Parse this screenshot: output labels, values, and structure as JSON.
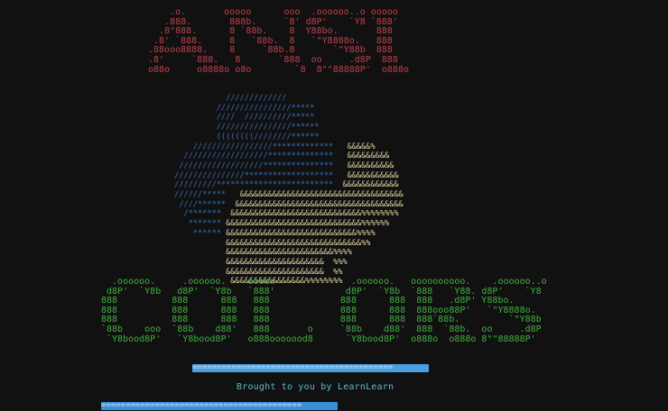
{
  "window": {
    "background": "#111111"
  },
  "ansi_art": {
    "color": "#c0404a",
    "lines": [
      "    .o.       ooooo      ooo  .oooooo..o ooooo",
      "   .888.       888b.     `8' d8P'    `Y8 `888'",
      "  .8\"888.      8 `88b.    8  Y88bo.       888",
      " .8' `888.     8   `88b.  8   `\"Y8888o.   888",
      ".88ooo8888.    8     `88b.8       `\"Y88b  888",
      ".8'     `888.   8       `888  oo     .d8P  888",
      "o88o     o8888o o8o        `8  8\"\"88888P'  o888o"
    ]
  },
  "python_logo": {
    "blue_color": "#3a6fb8",
    "yellow_color": "#e6d6a4",
    "lines": [
      {
        "blue": "            /////////////",
        "yellow": ""
      },
      {
        "blue": "          ////////////////*****",
        "yellow": ""
      },
      {
        "blue": "          ////  //////////*****",
        "yellow": ""
      },
      {
        "blue": "          ////////////////******",
        "yellow": ""
      },
      {
        "blue": "          ((((((((////////******",
        "yellow": ""
      },
      {
        "blue": "     /////////////////*************",
        "yellow": "   &&&&&%"
      },
      {
        "blue": "   //////////////////**************",
        "yellow": "   &&&&&&&&&"
      },
      {
        "blue": "  //////////////////***************",
        "yellow": "   &&&&&&&&&&"
      },
      {
        "blue": " ///////////////*******************",
        "yellow": "   &&&&&&&&&&&"
      },
      {
        "blue": " /////////*************************",
        "yellow": "  &&&&&&&&&&&&"
      },
      {
        "blue": " //////*****",
        "yellow": "   &&&&&&&&&&&&&&&&&&&&&&&&&&&&&&&&&&&"
      },
      {
        "blue": "  ////******",
        "yellow": "  &&&&&&&&&&&&&&&&&&&&&&&&&&&&&&&&&&&&"
      },
      {
        "blue": "   /*******",
        "yellow": "  &&&&&&&&&&&&&&&&&&&&&&&&&&&&%%%%%%%%"
      },
      {
        "blue": "    *******",
        "yellow": " &&&&&&&&&&&&&&&&&&&&&&&&&&&&&%%%%%%"
      },
      {
        "blue": "     ******",
        "yellow": " &&&&&&&&&&&&&&&&&&&&&&&&&&&&%%%%"
      },
      {
        "blue": "",
        "yellow": "            &&&&&&&&&&&&&&&&&&&&&&&&&&&&&%%"
      },
      {
        "blue": "",
        "yellow": "            &&&&&&&&&&&&&&&&&&&&&&&%%%%"
      },
      {
        "blue": "",
        "yellow": "            &&&&&&&&&&&&&&&&&&&&&  %%%"
      },
      {
        "blue": "",
        "yellow": "            &&&&&&&&&&&&&&&&&&&&&  %%"
      },
      {
        "blue": "",
        "yellow": "             &&&&&&&&&&&&&&&&%%%%%%%%"
      }
    ]
  },
  "colors_art": {
    "color": "#3fb13f",
    "lines": [
      "  .oooooo.     .oooooo.    ooooo              .oooooo.   oooooooooo.    .oooooo..o",
      " d8P'  `Y8b   d8P'  `Y8b   `888'             d8P'  `Y8b  `888   `Y88. d8P'    `Y8",
      "888          888      888   888             888      888  888   .d8P' Y88bo.",
      "888          888      888   888             888      888  888ooo88P'   `\"Y8888o.",
      "888          888      888   888             888      888  888`88b.         `\"Y88b",
      "`88b    ooo  `88b    d88'   888       o     `88b    d88'  888  `88b.  oo     .d8P",
      " `Y8bood8P'   `Y8bood8P'   o888ooooood8      `Y8bood8P'  o888o  o888o 8\"\"88888P'"
    ]
  },
  "divider_top": {
    "text": "=========================================",
    "color": "#4a9fe0"
  },
  "credit": {
    "text": "Brought to you by LearnLearn",
    "color": "#5fb8c8"
  },
  "divider_bottom": {
    "text": "=========================================",
    "color": "#3a8fd8"
  }
}
